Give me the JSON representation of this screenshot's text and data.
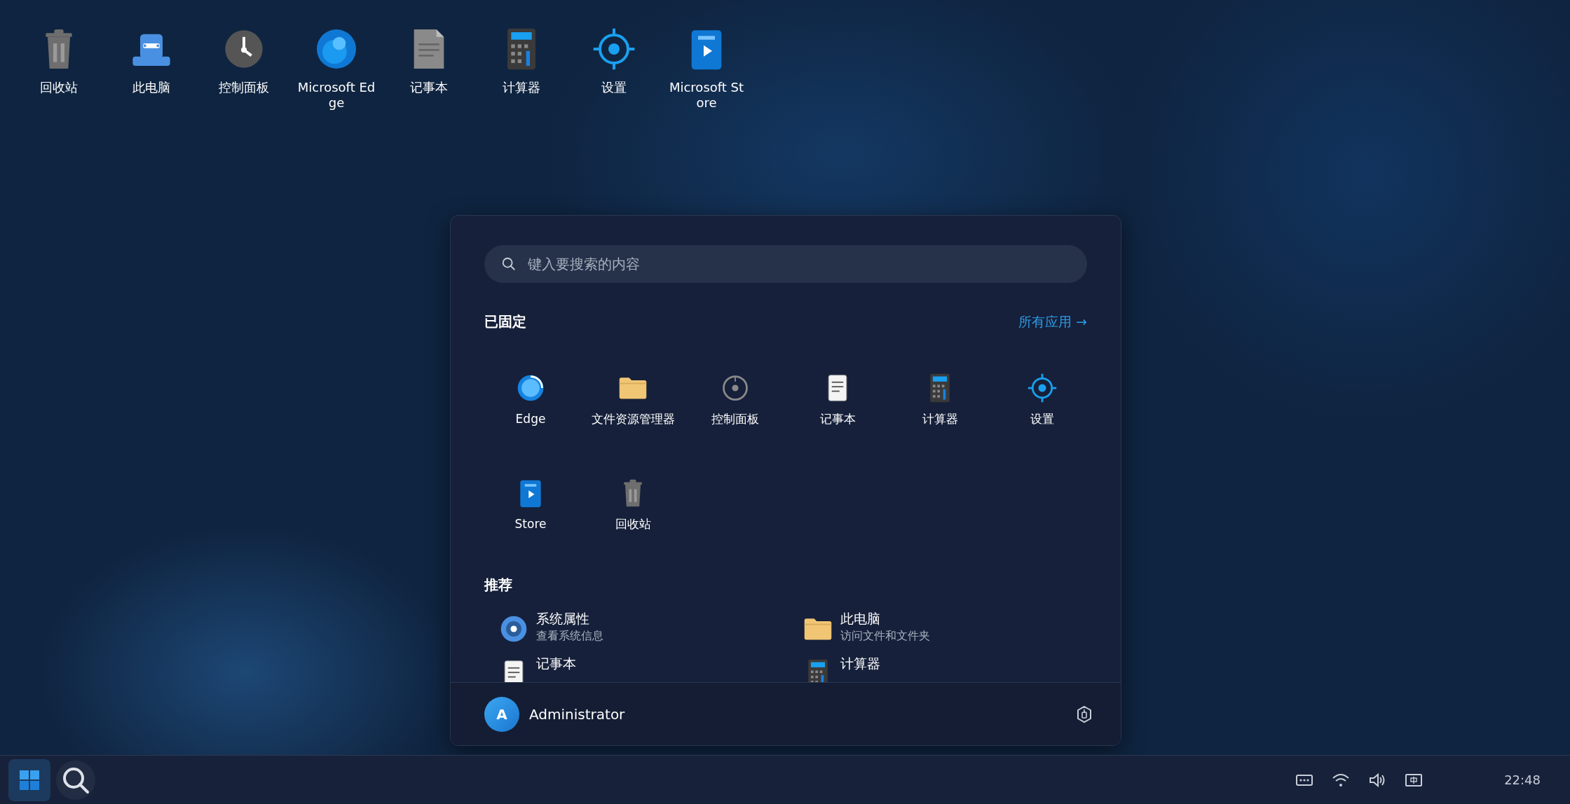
{
  "desktop_icons": [
    {
      "label": "回收站",
      "kind": "bin"
    },
    {
      "label": "此电脑",
      "kind": "computer"
    },
    {
      "label": "控制面板",
      "kind": "clock"
    },
    {
      "label": "Microsoft Edge",
      "kind": "orb"
    },
    {
      "label": "记事本",
      "kind": "document"
    },
    {
      "label": "计算器",
      "kind": "calculator"
    },
    {
      "label": "设置",
      "kind": "crosshair"
    },
    {
      "label": "Microsoft Store",
      "kind": "bag"
    }
  ],
  "start_menu": {
    "search": {
      "placeholder": "键入要搜索的内容"
    },
    "pinned_heading": "已固定",
    "all_apps_link": "所有应用 →",
    "pinned": [
      {
        "label": "Edge",
        "kind": "swirl"
      },
      {
        "label": "文件资源管理器",
        "kind": "folder"
      },
      {
        "label": "控制面板",
        "kind": "dial"
      },
      {
        "label": "记事本",
        "kind": "page"
      },
      {
        "label": "计算器",
        "kind": "calculator"
      },
      {
        "label": "设置",
        "kind": "crosshair"
      },
      {
        "label": "Store",
        "kind": "bag"
      },
      {
        "label": "回收站",
        "kind": "bin"
      }
    ],
    "recommended_heading": "推荐",
    "recommended": [
      {
        "title": "系统属性",
        "subtitle": "查看系统信息",
        "kind": "disc"
      },
      {
        "title": "此电脑",
        "subtitle": "访问文件和文件夹",
        "kind": "folder"
      },
      {
        "title": "记事本",
        "kind": "page"
      },
      {
        "title": "计算器",
        "kind": "calculator"
      }
    ],
    "user": {
      "avatar_letter": "A",
      "name": "Administrator"
    }
  },
  "taskbar": {
    "clock": {
      "time": "22:48"
    }
  }
}
